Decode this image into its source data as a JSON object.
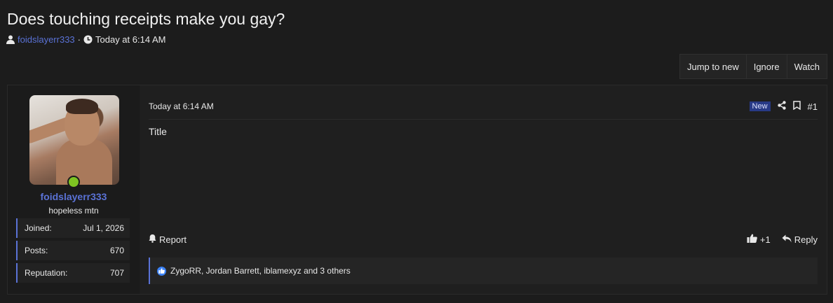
{
  "thread": {
    "title": "Does touching receipts make you gay?",
    "author": "foidslayerr333",
    "separator": "·",
    "posted": "Today at 6:14 AM"
  },
  "actions": [
    "Jump to new",
    "Ignore",
    "Watch"
  ],
  "user": {
    "name": "foidslayerr333",
    "title": "hopeless mtn",
    "status_color": "#7ec322",
    "stats": [
      {
        "label": "Joined:",
        "value": "Jul 1, 2026"
      },
      {
        "label": "Posts:",
        "value": "670"
      },
      {
        "label": "Reputation:",
        "value": "707"
      }
    ]
  },
  "post": {
    "date": "Today at 6:14 AM",
    "badge": "New",
    "number": "#1",
    "body": "Title",
    "report": "Report",
    "like_count": "+1",
    "reply": "Reply",
    "reactions": "ZygoRR, Jordan Barrett, iblamexyz and 3 others"
  },
  "colors": {
    "accent": "#5a72d6",
    "background": "#1c1c1c",
    "new_badge": "#283a86",
    "online": "#7ec322"
  },
  "icons": [
    "user-icon",
    "clock-icon",
    "share-icon",
    "bookmark-icon",
    "bell-icon",
    "thumbs-up-icon",
    "reply-icon",
    "like-reaction-icon"
  ]
}
